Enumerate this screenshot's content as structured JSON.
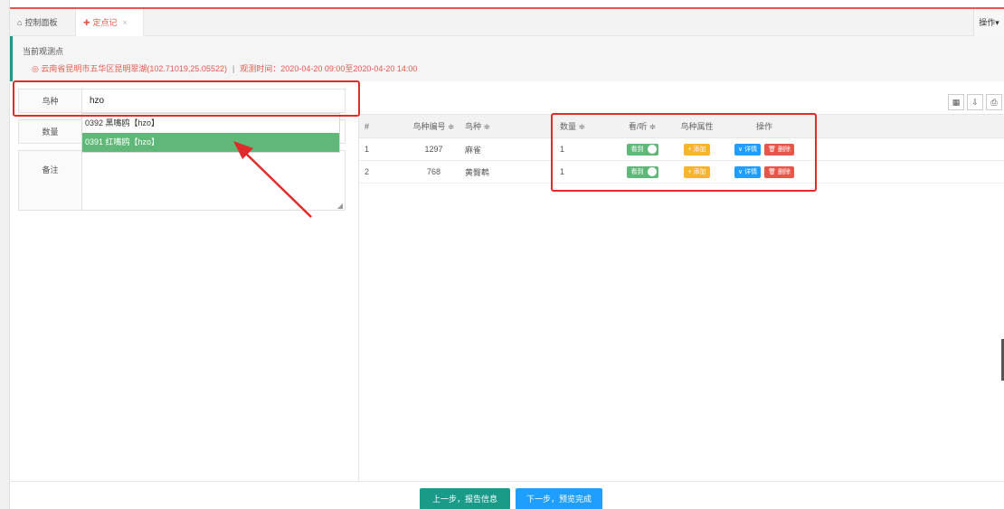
{
  "tabs": {
    "home_label": "控制面板",
    "active_label": "定点记",
    "close_glyph": "×",
    "ops_label": "操作▾"
  },
  "location": {
    "title": "当前观测点",
    "place": "云南省昆明市五华区昆明翠湖(102.71019,25.05522)",
    "separator": "|",
    "time": "观测时间：2020-04-20 09:00至2020-04-20 14:00"
  },
  "form": {
    "species_label": "鸟种",
    "species_value": "hzo",
    "qty_label": "数量",
    "note_label": "备注"
  },
  "dropdown": {
    "options": [
      "0392 黑嘴鸥【hzo】",
      "0391 红嘴鸥【hzo】"
    ],
    "selected_index": 1
  },
  "table": {
    "headers": {
      "idx": "#",
      "code": "鸟种编号 ≑",
      "name": "鸟种 ≑",
      "qty": "数量 ≑",
      "see": "看/听 ≑",
      "attr": "鸟种属性",
      "ops": "操作"
    },
    "rows": [
      {
        "idx": "1",
        "code": "1297",
        "name": "麻雀",
        "qty": "1",
        "see": "看到",
        "attr": "+ 添加",
        "detail": "∨ 详情",
        "del": "🗑 删除"
      },
      {
        "idx": "2",
        "code": "768",
        "name": "黄臀鹎",
        "qty": "1",
        "see": "看到",
        "attr": "+ 添加",
        "detail": "∨ 详情",
        "del": "🗑 删除"
      }
    ]
  },
  "footer": {
    "prev_label": "上一步，报告信息",
    "next_label": "下一步，预览完成"
  },
  "colors": {
    "accent_red": "#e8564a",
    "green": "#5fb878",
    "teal": "#1a9b8a",
    "blue": "#1e9fff",
    "orange": "#f7b52c",
    "annotation_red": "#e12b2b"
  }
}
